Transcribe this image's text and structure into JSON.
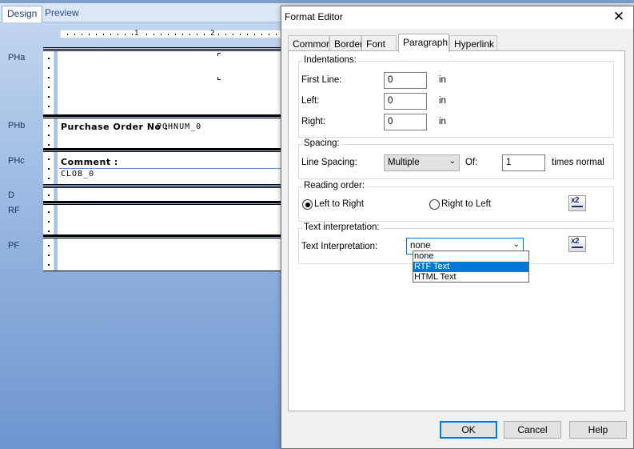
{
  "designer": {
    "tabs": {
      "design": "Design",
      "preview": "Preview"
    },
    "ruler": {
      "marks": [
        "1",
        "2"
      ]
    },
    "bands": {
      "pha": "PHa",
      "phb": "PHb",
      "phc": "PHc",
      "d": "D",
      "rf": "RF",
      "pf": "PF"
    },
    "fields": {
      "po_label": "Purchase Order No :",
      "po_value": "POHNUM_0",
      "comment_label": "Comment :",
      "comment_value": "CLOB_0"
    }
  },
  "dialog": {
    "title": "Format Editor",
    "close_glyph": "✕",
    "tabs": [
      "Common",
      "Border",
      "Font",
      "Paragraph",
      "Hyperlink"
    ],
    "active_tab": "Paragraph",
    "indentations": {
      "title": "Indentations:",
      "first_line_label": "First Line:",
      "first_line_value": "0",
      "left_label": "Left:",
      "left_value": "0",
      "right_label": "Right:",
      "right_value": "0",
      "unit": "in"
    },
    "spacing": {
      "title": "Spacing:",
      "line_spacing_label": "Line Spacing:",
      "line_spacing_value": "Multiple",
      "of_label": "Of:",
      "of_value": "1",
      "suffix": "times normal"
    },
    "reading_order": {
      "title": "Reading order:",
      "ltr_label": "Left to Right",
      "rtl_label": "Right to Left",
      "selected": "Left to Right"
    },
    "text_interpretation": {
      "title": "Text interpretation:",
      "label": "Text Interpretation:",
      "value": "none",
      "options": [
        "none",
        "RTF Text",
        "HTML Text"
      ],
      "highlighted": "RTF Text"
    },
    "expression_button_text": "x2",
    "buttons": {
      "ok": "OK",
      "cancel": "Cancel",
      "help": "Help"
    }
  }
}
